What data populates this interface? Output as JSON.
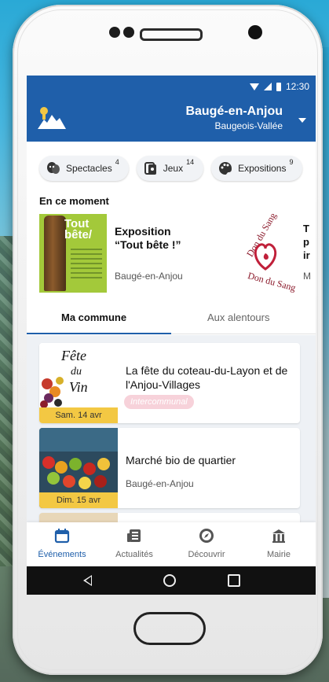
{
  "status_bar": {
    "time": "12:30"
  },
  "app_bar": {
    "city_name": "Baugé-en-Anjou",
    "city_sub": "Baugeois-Vallée"
  },
  "categories": [
    {
      "label": "Spectacles",
      "count": "4",
      "icon": "theater-masks-icon"
    },
    {
      "label": "Jeux",
      "count": "14",
      "icon": "playing-cards-icon"
    },
    {
      "label": "Expositions",
      "count": "9",
      "icon": "palette-icon"
    }
  ],
  "featured": {
    "heading": "En ce moment",
    "items": [
      {
        "title_line1": "Exposition",
        "title_line2": "“Tout bête !”",
        "location": "Baugé-en-Anjou",
        "thumb_text_1": "Tout",
        "thumb_text_2": "bête/"
      },
      {
        "title_line1": "T",
        "title_line2": "p",
        "title_line3": "ir",
        "location": "M",
        "logo_text_top": "Don du Sang",
        "logo_text_bottom": "Don du Sang"
      }
    ]
  },
  "tabs": {
    "tab1": "Ma commune",
    "tab2": "Aux alentours"
  },
  "events": [
    {
      "title": "La fête du coteau-du-Layon et de l'Anjou-Villages",
      "badge": "Intercommunal",
      "date": "Sam. 14 avr",
      "thumb_text_1": "Fête",
      "thumb_text_2": "du",
      "thumb_text_3": "Vin"
    },
    {
      "title": "Marché bio de quartier",
      "location": "Baugé-en-Anjou",
      "date": "Dim. 15 avr"
    }
  ],
  "bottom_nav": [
    {
      "label": "Événements",
      "icon": "calendar-icon"
    },
    {
      "label": "Actualités",
      "icon": "newspaper-icon"
    },
    {
      "label": "Découvrir",
      "icon": "compass-icon"
    },
    {
      "label": "Mairie",
      "icon": "town-hall-icon"
    }
  ],
  "colors": {
    "primary": "#1f5faa",
    "date_tag": "#f3c843",
    "badge": "#f7d2da"
  }
}
